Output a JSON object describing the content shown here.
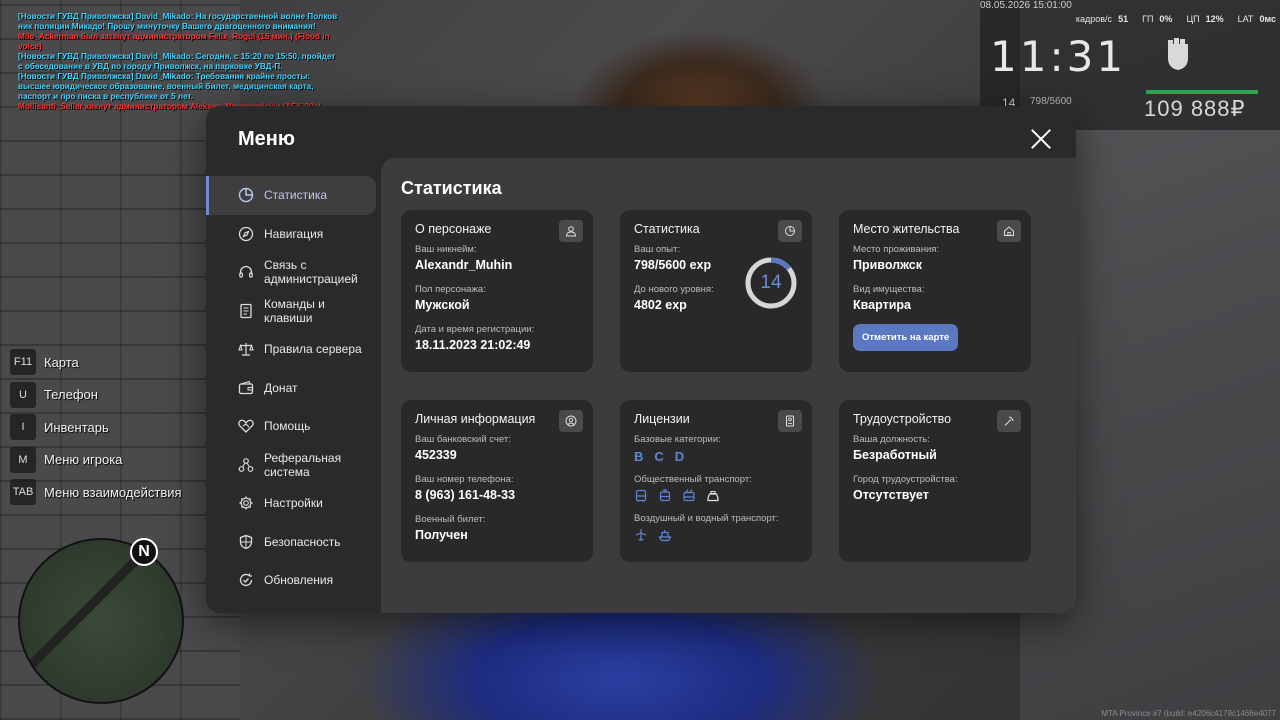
{
  "chat": [
    {
      "text": "[Новости ГУВД Приволжска] David_Mikado: На государственной волне Полков ник полиции Микадо! Прошу минуточку Вашего драгоценного внимания!",
      "kind": "news"
    },
    {
      "text": "Milo_Ackerman был заткнут администратором Felix_Rogui (15 мин.) (Flood in voice)",
      "kind": "admin"
    },
    {
      "text": "[Новости ГУВД Приволжска] David_Mikado: Сегодня, с 15:20 по 15:50, пройдет с обеседование в УВД по городу Приволжск, на парковке УВД-П.",
      "kind": "news"
    },
    {
      "text": "[Новости ГУВД Приволжска] David_Mikado: Требования крайне просты: высшее юридическое образование, военный билет, медицинская карта, паспорт и про писка в республике от 5 лет.",
      "kind": "news"
    },
    {
      "text": "Mollisanti_Seller кикнут администратором Aleksey_Novgorodskiy (AFK 30+)",
      "kind": "admin"
    }
  ],
  "hud": {
    "datetime": "08.05.2026 15:01:00",
    "fps_label": "кадров/с",
    "fps": "51",
    "gpu_label": "ГП",
    "gpu": "0%",
    "cpu_label": "ЦП",
    "cpu": "12%",
    "lat_label": "LAT",
    "lat": "0мс",
    "clock": "11:31",
    "level": "14",
    "exp": "798/5600",
    "money": "109 888₽"
  },
  "keys": [
    {
      "key": "F11",
      "label": "Карта"
    },
    {
      "key": "U",
      "label": "Телефон"
    },
    {
      "key": "I",
      "label": "Инвентарь"
    },
    {
      "key": "M",
      "label": "Меню игрока"
    },
    {
      "key": "TAB",
      "label": "Меню взаимодействия"
    }
  ],
  "minimap": {
    "north": "N"
  },
  "watermark": "MTA Province #7 (build: e4206c4179c1466e4077",
  "menu": {
    "title": "Меню",
    "nav": [
      {
        "label": "Статистика",
        "icon": "pie-chart-icon",
        "active": true
      },
      {
        "label": "Навигация",
        "icon": "compass-icon",
        "active": false
      },
      {
        "label": "Связь с администрацией",
        "icon": "headset-icon",
        "active": false
      },
      {
        "label": "Команды и клавиши",
        "icon": "document-icon",
        "active": false
      },
      {
        "label": "Правила сервера",
        "icon": "scales-icon",
        "active": false
      },
      {
        "label": "Донат",
        "icon": "wallet-icon",
        "active": false
      },
      {
        "label": "Помощь",
        "icon": "handshake-icon",
        "active": false
      },
      {
        "label": "Реферальная система",
        "icon": "network-icon",
        "active": false
      },
      {
        "label": "Настройки",
        "icon": "gear-icon",
        "active": false
      },
      {
        "label": "Безопасность",
        "icon": "shield-icon",
        "active": false
      },
      {
        "label": "Обновления",
        "icon": "refresh-check-icon",
        "active": false
      }
    ]
  },
  "content": {
    "title": "Статистика",
    "character": {
      "title": "О персонаже",
      "nick_label": "Ваш никнейм:",
      "nick": "Alexandr_Muhin",
      "sex_label": "Пол персонажа:",
      "sex": "Мужской",
      "reg_label": "Дата и время регистрации:",
      "reg": "18.11.2023 21:02:49"
    },
    "stats": {
      "title": "Статистика",
      "exp_label": "Ваш опыт:",
      "exp": "798/5600 exp",
      "next_label": "До нового уровня:",
      "next": "4802 exp",
      "level": "14",
      "progress": 0.1425
    },
    "residence": {
      "title": "Место жительства",
      "place_label": "Место проживания:",
      "place": "Приволжск",
      "prop_label": "Вид имущества:",
      "prop": "Квартира",
      "button": "Отметить на карте"
    },
    "personal": {
      "title": "Личная информация",
      "bank_label": "Ваш банковский счет:",
      "bank": "452339",
      "phone_label": "Ваш номер телефона:",
      "phone": "8 (963) 161-48-33",
      "military_label": "Военный билет:",
      "military": "Получен"
    },
    "licenses": {
      "title": "Лицензии",
      "base_label": "Базовые категории:",
      "base": [
        "B",
        "C",
        "D"
      ],
      "public_label": "Общественный транспорт:",
      "air_label": "Воздушный и водный транспорт:"
    },
    "job": {
      "title": "Трудоустройство",
      "post_label": "Ваша должность:",
      "post": "Безработный",
      "city_label": "Город трудоустройства:",
      "city": "Отсутствует"
    }
  }
}
